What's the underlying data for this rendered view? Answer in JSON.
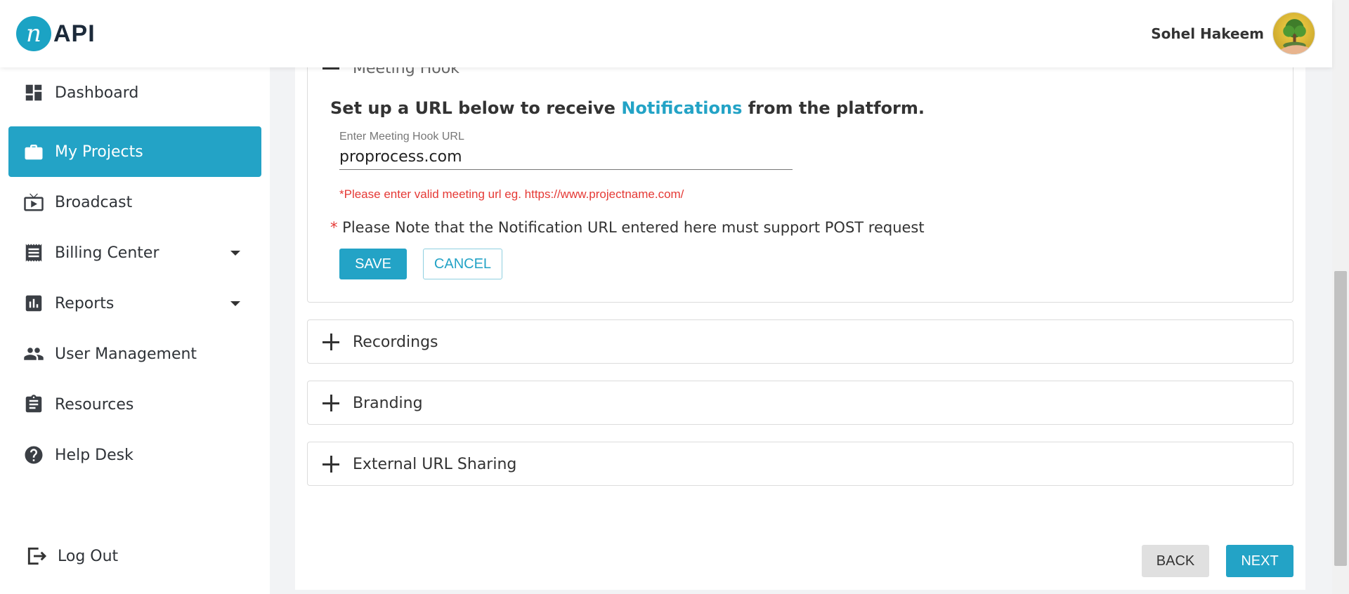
{
  "header": {
    "logo_mark": "n",
    "logo_text": "API",
    "user_name": "Sohel Hakeem"
  },
  "sidebar": {
    "items": [
      {
        "label": "Dashboard",
        "icon": "dashboard-icon"
      },
      {
        "label": "My Projects",
        "icon": "briefcase-icon",
        "active": true
      },
      {
        "label": "Broadcast",
        "icon": "tv-icon"
      },
      {
        "label": "Billing Center",
        "icon": "receipt-icon",
        "has_dropdown": true
      },
      {
        "label": "Reports",
        "icon": "bar-chart-icon",
        "has_dropdown": true
      },
      {
        "label": "User Management",
        "icon": "people-icon"
      },
      {
        "label": "Resources",
        "icon": "clipboard-icon"
      },
      {
        "label": "Help Desk",
        "icon": "help-icon"
      }
    ],
    "logout_label": "Log Out"
  },
  "meeting_hook": {
    "title": "Meeting Hook",
    "setup_prefix": "Set up a URL below to receive ",
    "setup_highlight": "Notifications",
    "setup_suffix": " from the platform.",
    "field_label": "Enter Meeting Hook URL",
    "field_value": "proprocess.com",
    "error": "*Please enter valid meeting url eg. https://www.projectname.com/",
    "note_star": "*",
    "note": " Please Note that the Notification URL entered here must support POST request",
    "save_label": "SAVE",
    "cancel_label": "CANCEL"
  },
  "panels": [
    {
      "title": "Recordings"
    },
    {
      "title": "Branding"
    },
    {
      "title": "External URL Sharing"
    }
  ],
  "footer": {
    "back_label": "BACK",
    "next_label": "NEXT"
  },
  "colors": {
    "accent": "#23a3c6",
    "error": "#e53935"
  }
}
